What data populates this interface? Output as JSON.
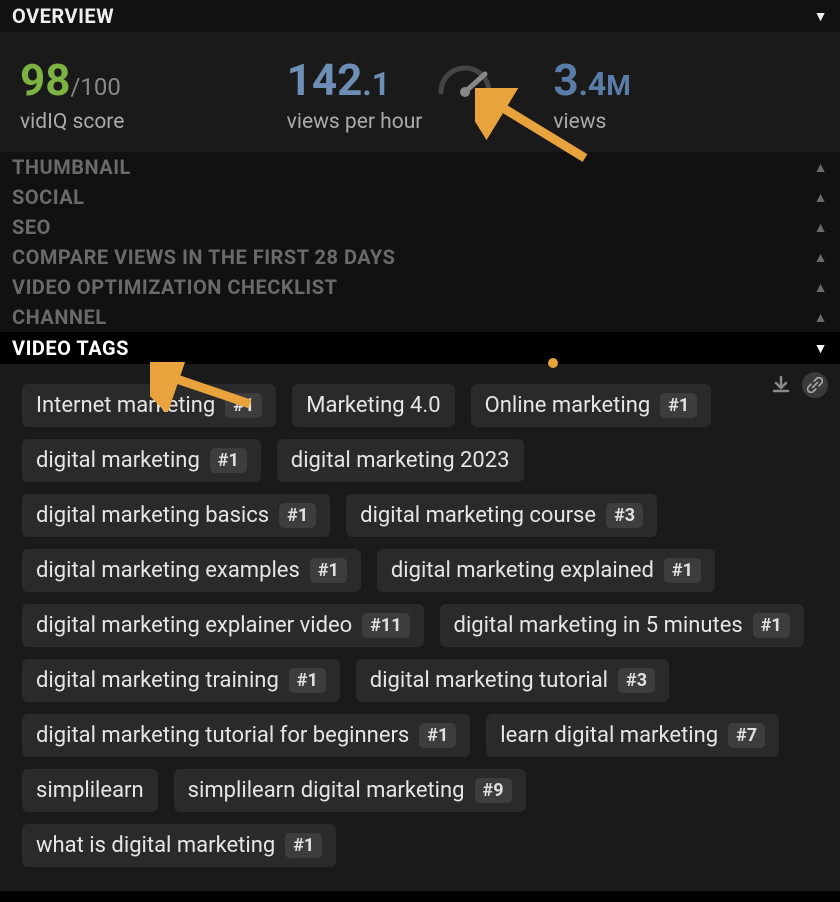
{
  "sections": {
    "overview": "OVERVIEW",
    "thumbnail": "THUMBNAIL",
    "social": "SOCIAL",
    "seo": "SEO",
    "compare": "COMPARE VIEWS IN THE FIRST 28 DAYS",
    "checklist": "VIDEO OPTIMIZATION CHECKLIST",
    "channel": "CHANNEL",
    "video_tags": "VIDEO TAGS"
  },
  "stats": {
    "score_main": "98",
    "score_max": "/100",
    "score_label": "vidIQ score",
    "vph_main": "142",
    "vph_dec": ".1",
    "vph_label": "views per hour",
    "views_main": "3",
    "views_dec": ".4",
    "views_unit": "M",
    "views_label": "views"
  },
  "tags": [
    {
      "label": "Internet marketing",
      "rank": "#1"
    },
    {
      "label": "Marketing 4.0",
      "rank": null
    },
    {
      "label": "Online marketing",
      "rank": "#1"
    },
    {
      "label": "digital marketing",
      "rank": "#1"
    },
    {
      "label": "digital marketing 2023",
      "rank": null
    },
    {
      "label": "digital marketing basics",
      "rank": "#1"
    },
    {
      "label": "digital marketing course",
      "rank": "#3"
    },
    {
      "label": "digital marketing examples",
      "rank": "#1"
    },
    {
      "label": "digital marketing explained",
      "rank": "#1"
    },
    {
      "label": "digital marketing explainer video",
      "rank": "#11"
    },
    {
      "label": "digital marketing in 5 minutes",
      "rank": "#1"
    },
    {
      "label": "digital marketing training",
      "rank": "#1"
    },
    {
      "label": "digital marketing tutorial",
      "rank": "#3"
    },
    {
      "label": "digital marketing tutorial for beginners",
      "rank": "#1"
    },
    {
      "label": "learn digital marketing",
      "rank": "#7"
    },
    {
      "label": "simplilearn",
      "rank": null
    },
    {
      "label": "simplilearn digital marketing",
      "rank": "#9"
    },
    {
      "label": "what is digital marketing",
      "rank": "#1"
    }
  ]
}
